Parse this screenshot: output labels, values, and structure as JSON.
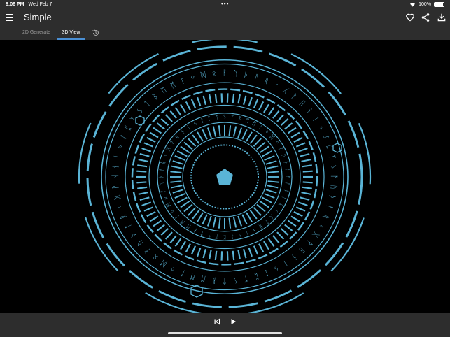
{
  "status_bar": {
    "time": "8:06 PM",
    "date": "Wed Feb 7",
    "dots": "•••",
    "battery_percent": "100%",
    "battery_level": 1.0
  },
  "app_bar": {
    "title": "Simple",
    "icons": [
      "menu-icon",
      "heart-icon",
      "share-icon",
      "download-icon"
    ]
  },
  "tabs": [
    {
      "label": "2D Generate",
      "active": false
    },
    {
      "label": "3D View",
      "active": true
    }
  ],
  "tab_icon": "history-icon",
  "viewport": {
    "content": "rune-circle-3d",
    "accent_color": "#5ab4d6",
    "background": "#000000",
    "runes": "ᚠᚢᚦᚨᚱᚲᚷᚹᚺᚾᛁᛃᛇᛈᛉᛊᛏᛒᛖᛗᛚᛜᛞᛟ"
  },
  "player": {
    "icons": [
      "skip-previous-icon",
      "play-icon"
    ]
  },
  "colors": {
    "bar_bg": "#2d2d2d",
    "tab_indicator": "#4a8fd4",
    "inactive_text": "#9a9a9a"
  }
}
